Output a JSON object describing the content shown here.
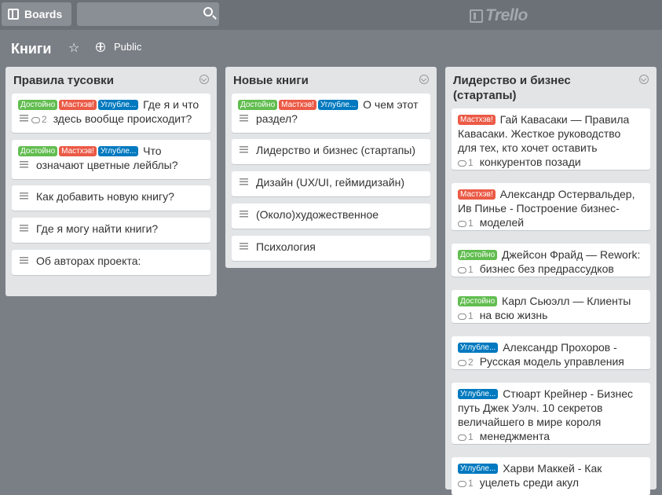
{
  "topbar": {
    "boards_label": "Boards",
    "logo_text": "Trello"
  },
  "board": {
    "title": "Книги",
    "visibility": "Public"
  },
  "labels": {
    "green": "Достойно",
    "red": "Мастхэв!",
    "blue": "Углубле..."
  },
  "lists": [
    {
      "title": "Правила тусовки",
      "cards": [
        {
          "line1": "Где я и что",
          "line2": "здесь вообще происходит?",
          "comments": "2"
        },
        {
          "line1": "Что",
          "line2": "означают цветные лейблы?"
        },
        {
          "text": "Как добавить новую книгу?"
        },
        {
          "text": "Где я могу найти книги?"
        },
        {
          "text": "Об авторах проекта:"
        }
      ]
    },
    {
      "title": "Новые книги",
      "cards": [
        {
          "line1": "О чем этот",
          "line2": "раздел?"
        },
        {
          "text": "Лидерство и бизнес (стартапы)"
        },
        {
          "text": "Дизайн (UX/UI, геймидизайн)"
        },
        {
          "text": "(Около)художественное"
        },
        {
          "text": "Психология"
        }
      ]
    },
    {
      "title_line1": "Лидерство и бизнес",
      "title_line2": "(стартапы)",
      "cards": [
        {
          "l1": "Гай Кавасаки — Правила",
          "l2": "Кавасаки. Жесткое руководство",
          "l3": "для тех, кто хочет оставить",
          "l4": "конкурентов позади",
          "comments": "1"
        },
        {
          "l1": "Александр Остервальдер,",
          "l2": "Ив Пинье - Построение бизнес-",
          "l3": "моделей",
          "comments": "1"
        },
        {
          "l1": "Джейсон Фрайд — Rework:",
          "l2": "бизнес без предрассудков",
          "comments": "1"
        },
        {
          "l1": "Карл Сьюэлл — Клиенты",
          "l2": "на всю жизнь",
          "comments": "1"
        },
        {
          "l1": "Александр Прохоров -",
          "l2": "Русская модель управления",
          "comments": "2"
        },
        {
          "l1": "Стюарт Крейнер - Бизнес",
          "l2": "путь Джек Уэлч. 10 секретов",
          "l3": "величайшего в мире короля",
          "l4": "менеджмента",
          "comments": "1"
        },
        {
          "l1": "Харви Маккей - Как",
          "l2": "уцелеть среди акул",
          "comments": "1"
        }
      ]
    }
  ]
}
